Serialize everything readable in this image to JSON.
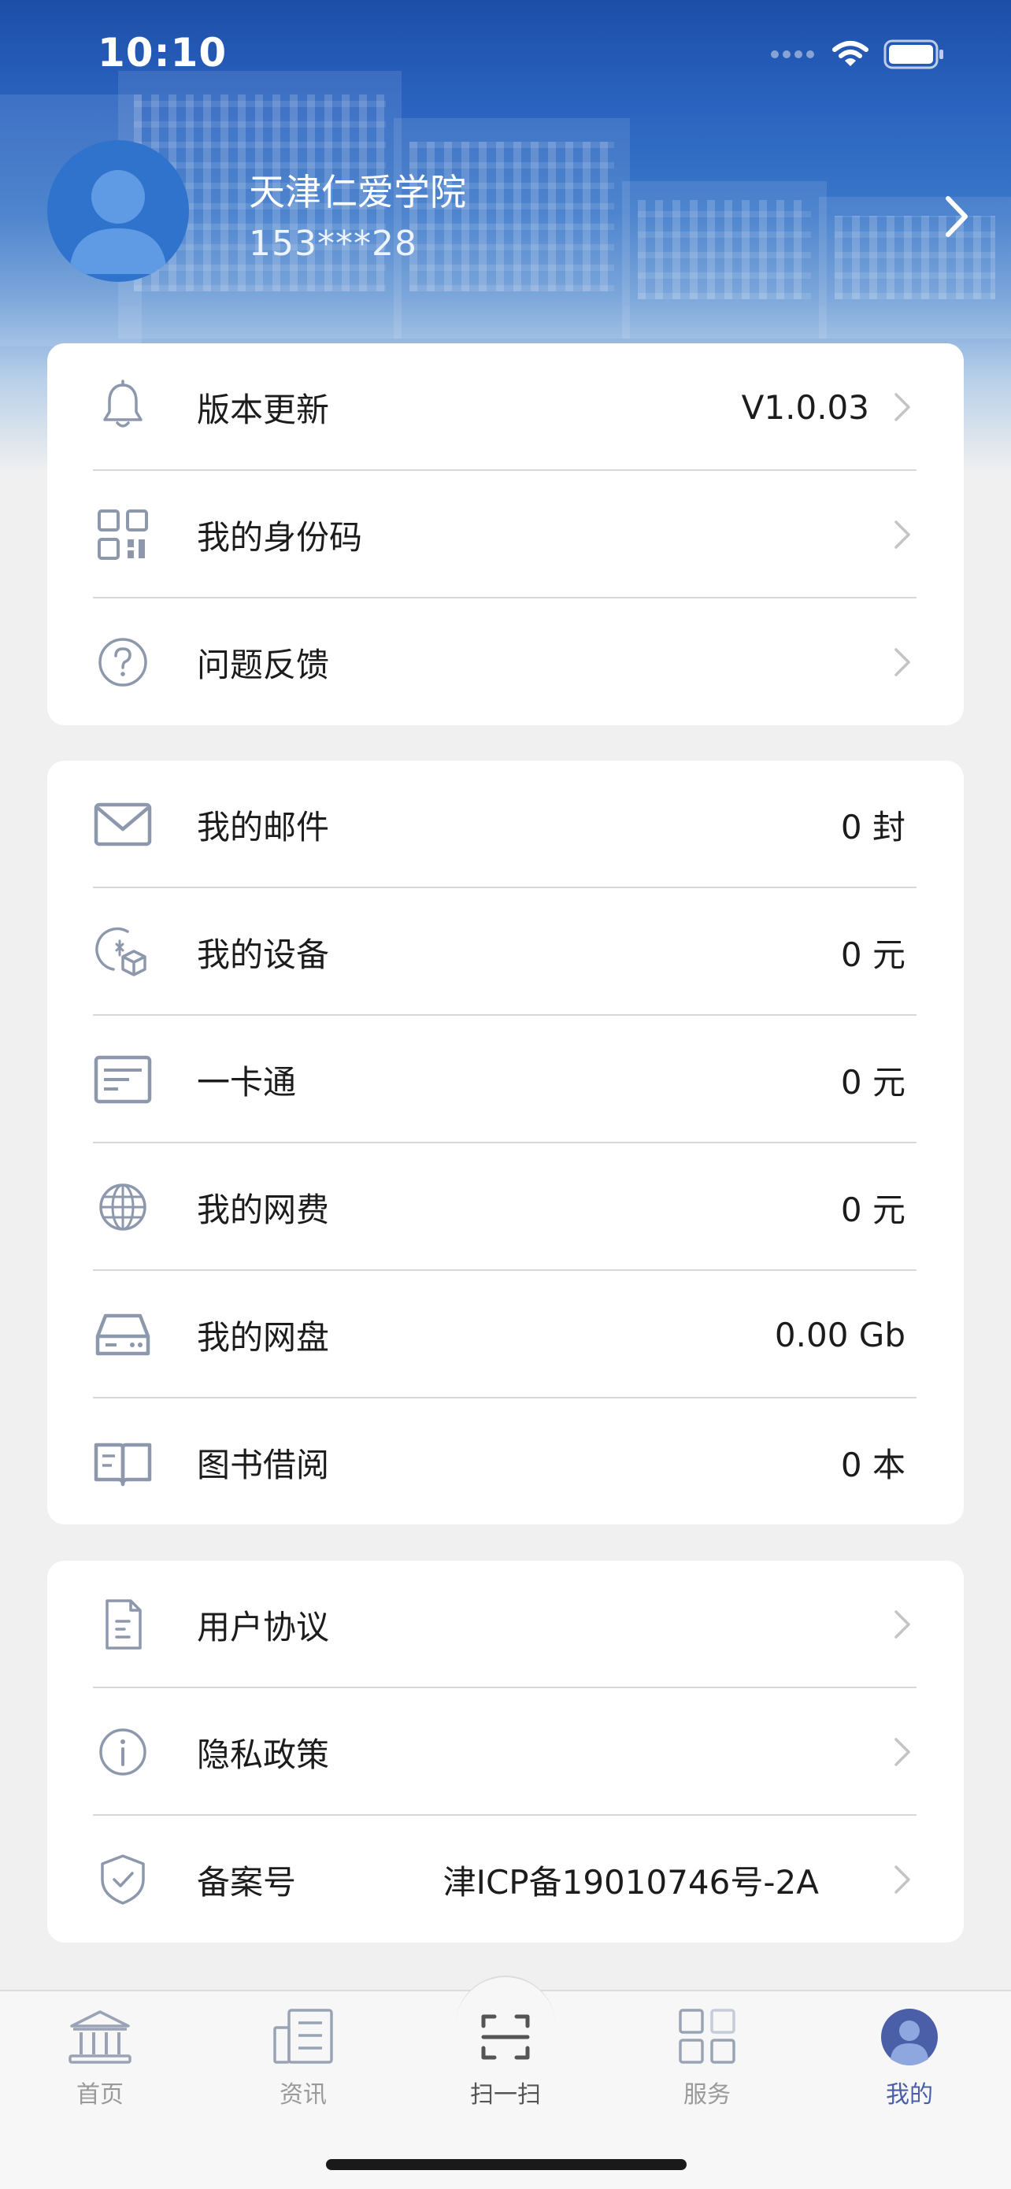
{
  "status_bar": {
    "time": "10:10"
  },
  "profile": {
    "name": "天津仁爱学院",
    "phone": "153***28"
  },
  "card1": [
    {
      "label": "版本更新",
      "value": "V1.0.03",
      "icon": "bell-icon"
    },
    {
      "label": "我的身份码",
      "value": "",
      "icon": "qr-code-icon"
    },
    {
      "label": "问题反馈",
      "value": "",
      "icon": "help-circle-icon"
    }
  ],
  "card2": [
    {
      "label": "我的邮件",
      "value": "0 封",
      "icon": "mail-icon"
    },
    {
      "label": "我的设备",
      "value": "0 元",
      "icon": "device-box-icon"
    },
    {
      "label": "一卡通",
      "value": "0 元",
      "icon": "card-icon"
    },
    {
      "label": "我的网费",
      "value": "0 元",
      "icon": "globe-icon"
    },
    {
      "label": "我的网盘",
      "value": "0.00 Gb",
      "icon": "disk-icon"
    },
    {
      "label": "图书借阅",
      "value": "0 本",
      "icon": "book-icon"
    }
  ],
  "card3": [
    {
      "label": "用户协议",
      "value": "",
      "icon": "document-icon"
    },
    {
      "label": "隐私政策",
      "value": "",
      "icon": "info-circle-icon"
    },
    {
      "label": "备案号",
      "value": "津ICP备19010746号-2A",
      "icon": "shield-check-icon"
    }
  ],
  "tabs": [
    {
      "label": "首页",
      "icon": "building-icon"
    },
    {
      "label": "资讯",
      "icon": "news-icon"
    },
    {
      "label": "扫一扫",
      "icon": "scan-icon"
    },
    {
      "label": "服务",
      "icon": "grid-icon"
    },
    {
      "label": "我的",
      "icon": "user-avatar-icon",
      "active": true
    }
  ],
  "colors": {
    "icon_gray": "#8e98ad",
    "accent": "#4a5fa8",
    "hero_blue": "#1c4ea8"
  }
}
